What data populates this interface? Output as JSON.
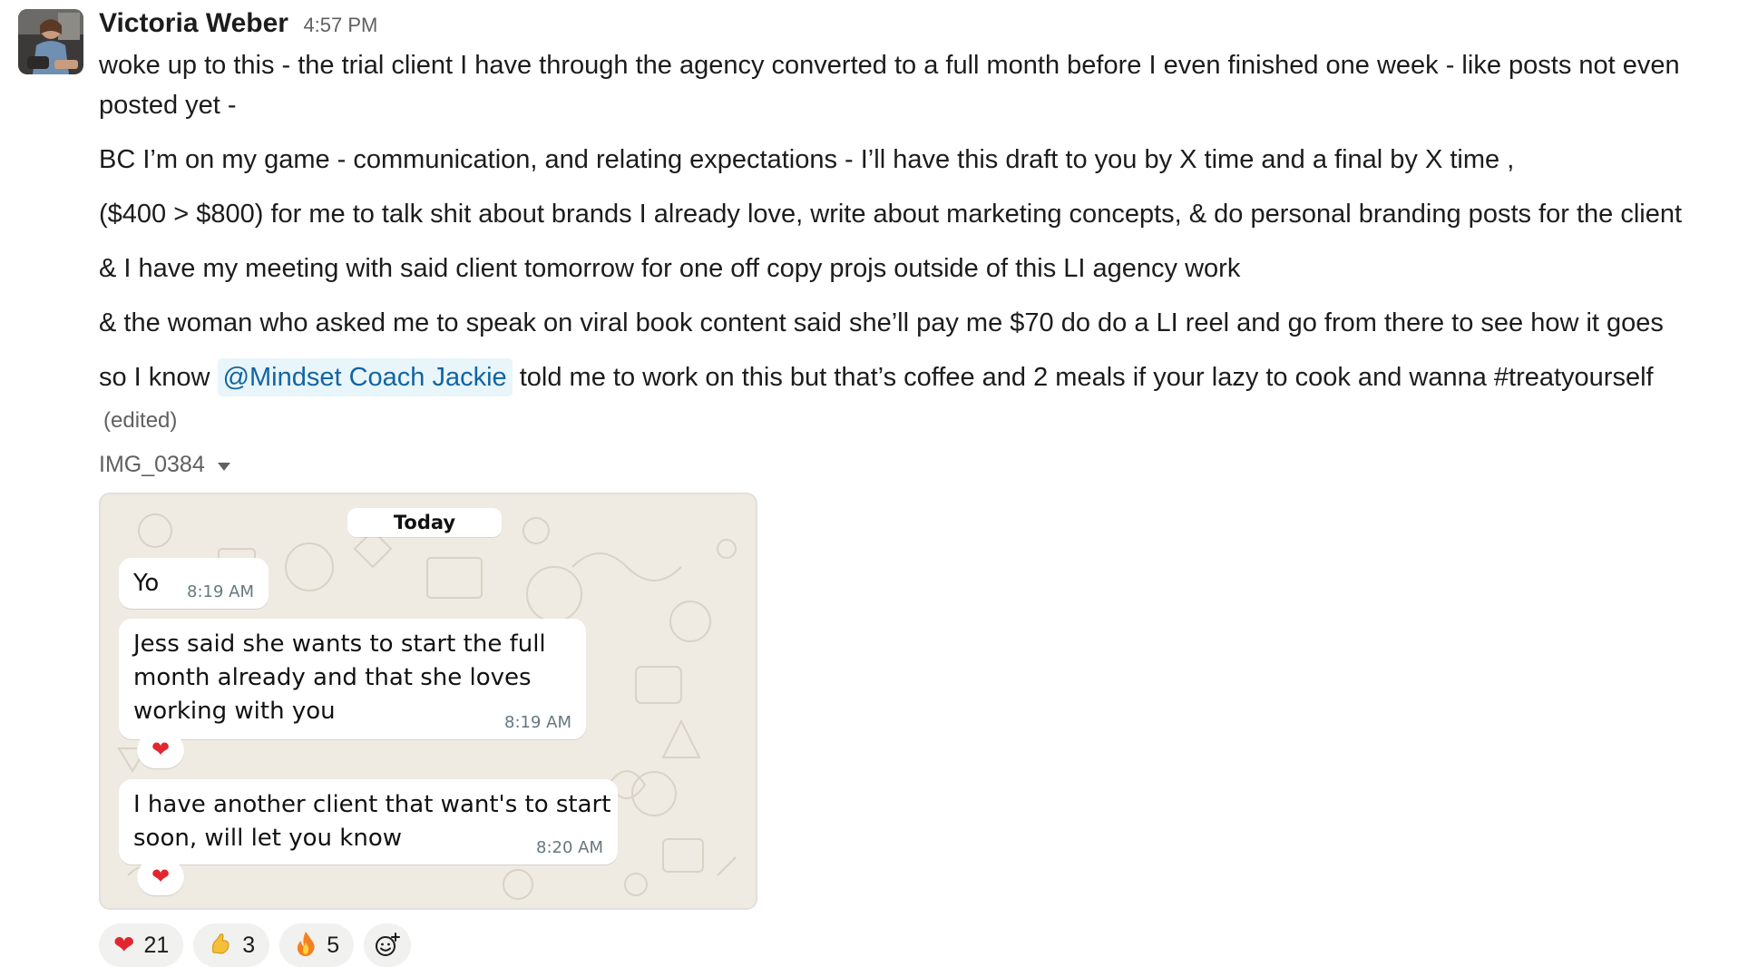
{
  "message": {
    "author": "Victoria Weber",
    "time": "4:57 PM",
    "paragraphs": [
      "woke up to this - the trial client I have through the agency converted to a full month before I even finished one week - like posts not even posted yet -",
      "BC I’m on my game - communication, and relating expectations - I’ll have this draft to you by X time and a final by X time ,",
      "($400 > $800) for me to talk shit about brands I already love, write about marketing concepts, & do personal branding posts for the client",
      "& I have my meeting with said client tomorrow for one off copy projs outside of this LI agency work",
      "& the woman who asked me to speak on viral book content said she’ll pay me $70 do do a LI reel and go from there to see how it goes"
    ],
    "last_paragraph": {
      "before": "so I know ",
      "mention": "@Mindset Coach Jackie",
      "after": " told me to work on this but that’s coffee and 2 meals if your lazy to cook and wanna #treatyourself"
    },
    "edited": "(edited)"
  },
  "attachment": {
    "filename": "IMG_0384",
    "chat": {
      "date": "Today",
      "messages": [
        {
          "text": "Yo",
          "time": "8:19 AM"
        },
        {
          "lines": [
            "Jess said she wants to start the full",
            "month already and that she loves",
            "working with you"
          ],
          "time": "8:19 AM",
          "reaction": "❤"
        },
        {
          "lines": [
            "I have another client that want's to start",
            "soon, will let you know"
          ],
          "time": "8:20 AM",
          "reaction": "❤"
        }
      ]
    }
  },
  "reactions": [
    {
      "emoji": "❤",
      "emoji_name": "heart",
      "count": "21",
      "color": "#e0262f"
    },
    {
      "emoji": "🤌",
      "emoji_name": "pinched-fingers",
      "count": "3",
      "color": "#f4c03b"
    },
    {
      "emoji": "🔥",
      "emoji_name": "fire",
      "count": "5",
      "color": "#f4811f"
    }
  ],
  "add_reaction_icon": "add-emoji-icon"
}
